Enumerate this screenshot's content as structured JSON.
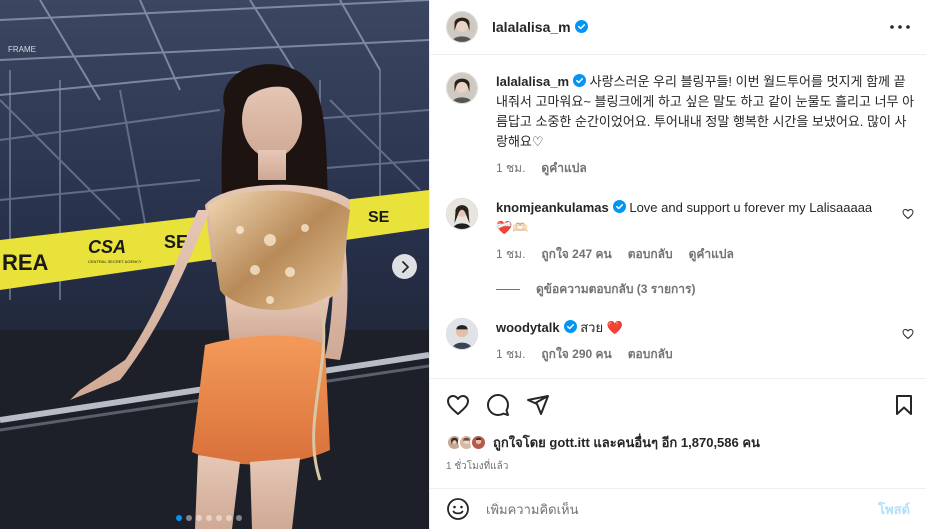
{
  "colors": {
    "accent": "#0095f6",
    "verified": "#0095f6",
    "heart_red": "#ed4956",
    "muted": "#737373",
    "post_disabled": "#b2dffc"
  },
  "media": {
    "banner_text_1": "REA",
    "banner_text_2": "CSA",
    "banner_text_3": "SE",
    "banner_text_4": "SE",
    "banner_sub": "CENTRAL SECRET AGENCY",
    "frame_label": "FRAME",
    "dots_count": 7,
    "active_dot": 0,
    "next_icon": "chevron-right-icon"
  },
  "header": {
    "username": "lalalalisa_m",
    "verified_icon": "verified-badge-icon",
    "more_icon": "more-horizontal-icon"
  },
  "caption": {
    "username": "lalalalisa_m",
    "text": "사랑스러운 우리 블링꾸들! 이번 월드투어를 멋지게 함께 끝내줘서 고마워요~ 블링크에게 하고 싶은 말도 하고 같이 눈물도 흘리고 너무 아름답고 소중한 순간이었어요. 투어내내 정말 행복한 시간을 보냈어요. 많이 사랑해요♡",
    "time": "1 ชม.",
    "translate": "ดูคำแปล"
  },
  "comments": [
    {
      "username": "knomjeankulamas",
      "text": "Love and support u forever my Lalisaaaaa",
      "emoji": "❤️‍🩹🫶🏻",
      "time": "1 ชม.",
      "likes": "ถูกใจ 247 คน",
      "reply": "ตอบกลับ",
      "translate": "ดูคำแปล",
      "view_replies": "ดูข้อความตอบกลับ (3 รายการ)"
    },
    {
      "username": "woodytalk",
      "text": "สวย",
      "emoji": "❤️",
      "time": "1 ชม.",
      "likes": "ถูกใจ 290 คน",
      "reply": "ตอบกลับ"
    }
  ],
  "actions": {
    "like_icon": "heart-icon",
    "comment_icon": "comment-icon",
    "share_icon": "share-icon",
    "save_icon": "bookmark-icon"
  },
  "likes": {
    "prefix": "ถูกใจโดย",
    "first_user": "gott.itt",
    "rest": "และคนอื่นๆ อีก 1,870,586 คน"
  },
  "posted_ago": "1 ชั่วโมงที่แล้ว",
  "add_comment": {
    "placeholder": "เพิ่มความคิดเห็น",
    "post_label": "โพสต์",
    "emoji_icon": "smiley-icon"
  }
}
